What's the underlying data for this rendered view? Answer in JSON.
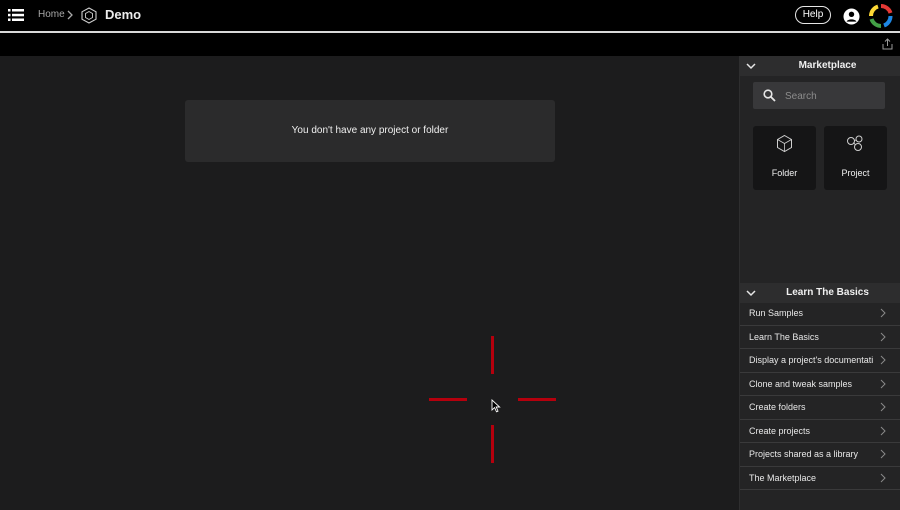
{
  "header": {
    "breadcrumb_home": "Home",
    "title": "Demo",
    "help_label": "Help",
    "icons": {
      "menu": "menu-icon",
      "project": "cube-icon",
      "user": "user-icon",
      "logo": "brand-logo"
    }
  },
  "toolbar": {
    "export_icon": "export-icon"
  },
  "main": {
    "empty_message": "You don't have any project or folder"
  },
  "marketplace": {
    "title": "Marketplace",
    "search_placeholder": "Search",
    "tiles": [
      {
        "label": "Folder",
        "icon": "folder-cube-icon"
      },
      {
        "label": "Project",
        "icon": "project-nodes-icon"
      }
    ]
  },
  "basics": {
    "title": "Learn The Basics",
    "items": [
      "Run Samples",
      "Learn The Basics",
      "Display a project's documentati",
      "Clone and tweak samples",
      "Create folders",
      "Create projects",
      "Projects shared as a library",
      "The Marketplace"
    ]
  },
  "colors": {
    "crosshair": "#b5000d",
    "panel": "#242425",
    "background": "#1c1c1d"
  }
}
